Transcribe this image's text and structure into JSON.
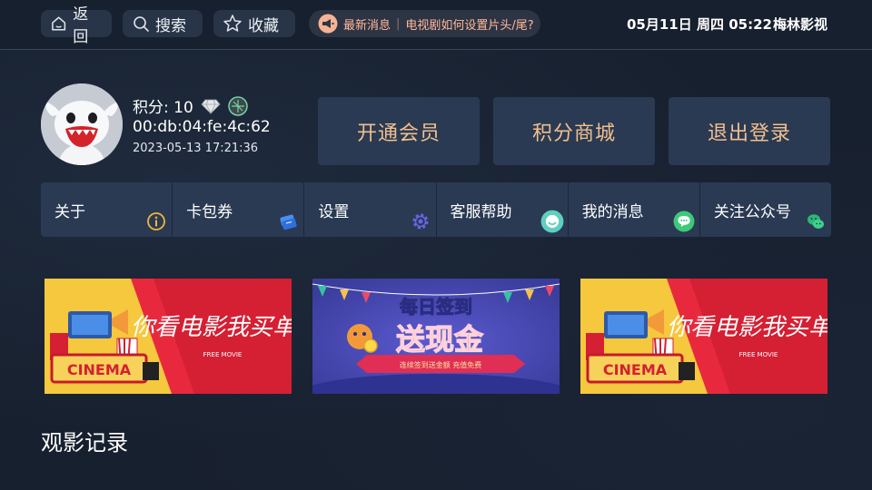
{
  "topbar": {
    "back_label": "返回",
    "search_label": "搜索",
    "favorites_label": "收藏",
    "news": {
      "tag": "最新消息",
      "text": "电视剧如何设置片头/尾?"
    },
    "datetime": "05月11日 周四 05:22",
    "brand": "梅林影视"
  },
  "profile": {
    "points_label": "积分: 10",
    "mac": "00:db:04:fe:4c:62",
    "date": "2023-05-13 17:21:36"
  },
  "actions": {
    "vip_label": "开通会员",
    "shop_label": "积分商城",
    "logout_label": "退出登录"
  },
  "nav": {
    "items": [
      {
        "label": "关于",
        "icon": "info-icon"
      },
      {
        "label": "卡包券",
        "icon": "coupon-icon"
      },
      {
        "label": "设置",
        "icon": "gear-icon"
      },
      {
        "label": "客服帮助",
        "icon": "support-icon"
      },
      {
        "label": "我的消息",
        "icon": "message-icon"
      },
      {
        "label": "关注公众号",
        "icon": "wechat-icon"
      }
    ]
  },
  "banners": {
    "cinema": {
      "slogan": "你看电影我买单",
      "sub": "FREE MOVIE",
      "sign": "CINEMA"
    },
    "checkin": {
      "title": "每日签到",
      "main": "送现金",
      "ribbon": "连续签到送金额 充值免费"
    }
  },
  "history": {
    "title": "观影记录"
  },
  "colors": {
    "accent_gold": "#f2bf8e",
    "tile_bg": "#2a3a53",
    "page_bg": "#17202e"
  }
}
